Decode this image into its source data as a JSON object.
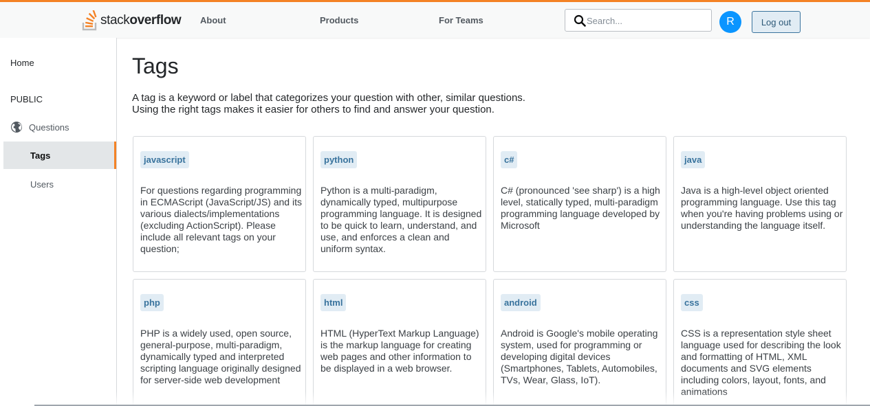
{
  "header": {
    "logo_text_light": "stack",
    "logo_text_bold": "overflow",
    "nav": [
      "About",
      "Products",
      "For Teams"
    ],
    "search_placeholder": "Search...",
    "avatar_initial": "R",
    "logout_label": "Log out",
    "accent_color": "#f48225"
  },
  "sidebar": {
    "home": "Home",
    "section": "PUBLIC",
    "items": [
      {
        "label": "Questions",
        "icon": "globe-icon"
      },
      {
        "label": "Tags",
        "active": true
      },
      {
        "label": "Users"
      }
    ]
  },
  "main": {
    "title": "Tags",
    "intro_line1": "A tag is a keyword or label that categorizes your question with other, similar questions.",
    "intro_line2": "Using the right tags makes it easier for others to find and answer your question.",
    "tags": [
      {
        "name": "javascript",
        "desc": "For questions regarding programming in ECMAScript (JavaScript/JS) and its various dialects/implementations (excluding ActionScript). Please include all relevant tags on your question;"
      },
      {
        "name": "python",
        "desc": "Python is a multi-paradigm, dynamically typed, multipurpose programming language. It is designed to be quick to learn, understand, and use, and enforces a clean and uniform syntax."
      },
      {
        "name": "c#",
        "desc": "C# (pronounced 'see sharp') is a high level, statically typed, multi-paradigm programming language developed by Microsoft"
      },
      {
        "name": "java",
        "desc": "Java is a high-level object oriented programming language. Use this tag when you're having problems using or understanding the language itself."
      },
      {
        "name": "php",
        "desc": "PHP is a widely used, open source, general-purpose, multi-paradigm, dynamically typed and interpreted scripting language originally designed for server-side web development"
      },
      {
        "name": "html",
        "desc": "HTML (HyperText Markup Language) is the markup language for creating web pages and other information to be displayed in a web browser."
      },
      {
        "name": "android",
        "desc": "Android is Google's mobile operating system, used for programming or developing digital devices (Smartphones, Tablets, Automobiles, TVs, Wear, Glass, IoT)."
      },
      {
        "name": "css",
        "desc": "CSS is a representation style sheet language used for describing the look and formatting of HTML, XML documents and SVG elements including colors, layout, fonts, and animations"
      }
    ]
  }
}
